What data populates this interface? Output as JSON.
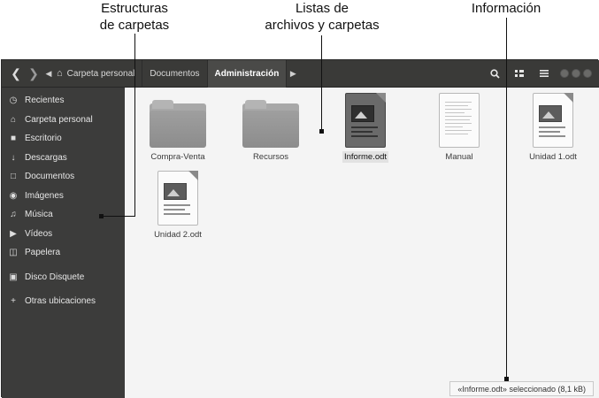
{
  "annotations": {
    "sidebar_callout": {
      "line1": "Estructuras",
      "line2": "de carpetas"
    },
    "files_callout": {
      "line1": "Listas de",
      "line2": "archivos y carpetas"
    },
    "info_callout": "Información"
  },
  "toolbar": {
    "back_icon": "chevron-left-icon",
    "forward_icon": "chevron-right-icon",
    "breadcrumbs": [
      "Carpeta personal",
      "Documentos",
      "Administración"
    ],
    "search_icon": "search-icon",
    "view_icon": "grid-view-icon",
    "menu_icon": "hamburger-menu-icon"
  },
  "sidebar": {
    "items": [
      {
        "label": "Recientes",
        "icon": "clock-icon"
      },
      {
        "label": "Carpeta personal",
        "icon": "home-icon"
      },
      {
        "label": "Escritorio",
        "icon": "desktop-folder-icon"
      },
      {
        "label": "Descargas",
        "icon": "download-icon"
      },
      {
        "label": "Documentos",
        "icon": "document-icon"
      },
      {
        "label": "Imágenes",
        "icon": "camera-icon"
      },
      {
        "label": "Música",
        "icon": "music-icon"
      },
      {
        "label": "Vídeos",
        "icon": "video-icon"
      },
      {
        "label": "Papelera",
        "icon": "trash-icon"
      }
    ],
    "devices": [
      {
        "label": "Disco Disquete",
        "icon": "floppy-disk-icon"
      },
      {
        "label": "Otras ubicaciones",
        "icon": "plus-icon"
      }
    ]
  },
  "files": [
    {
      "name": "Compra-Venta",
      "type": "folder"
    },
    {
      "name": "Recursos",
      "type": "folder"
    },
    {
      "name": "Informe.odt",
      "type": "odt",
      "selected": true
    },
    {
      "name": "Manual",
      "type": "text"
    },
    {
      "name": "Unidad 1.odt",
      "type": "odt"
    },
    {
      "name": "Unidad 2.odt",
      "type": "odt"
    }
  ],
  "status": "«Informe.odt» seleccionado  (8,1 kB)",
  "colors": {
    "sidebar_bg": "#3c3c3b",
    "content_bg": "#f4f4f4",
    "headerbar_bg": "#3a3a38"
  }
}
